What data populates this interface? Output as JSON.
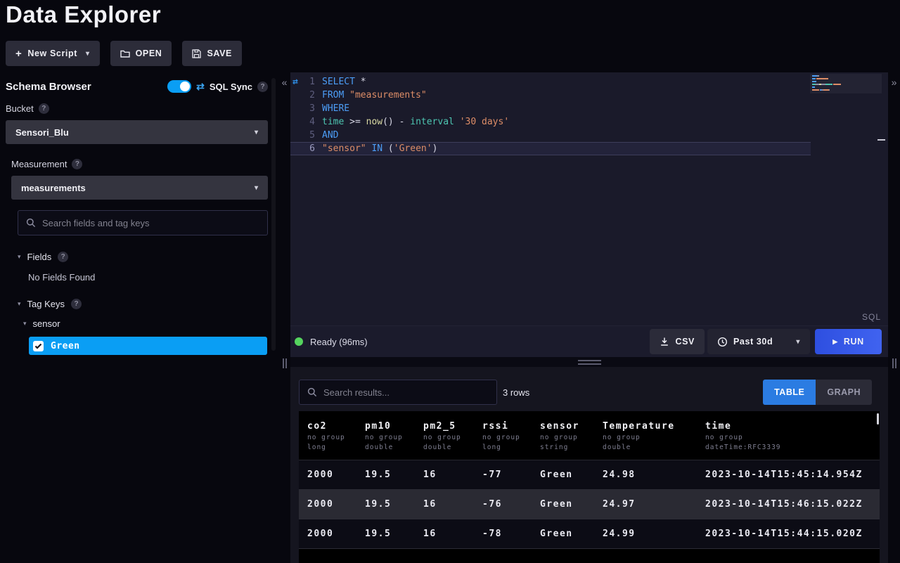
{
  "header": {
    "title": "Data Explorer"
  },
  "toolbar": {
    "new_script": {
      "label": "New Script"
    },
    "open": {
      "label": "OPEN"
    },
    "save": {
      "label": "SAVE"
    }
  },
  "schema_browser": {
    "title": "Schema Browser",
    "sql_sync_label": "SQL Sync",
    "bucket": {
      "label": "Bucket",
      "value": "Sensori_Blu"
    },
    "measurement": {
      "label": "Measurement",
      "value": "measurements"
    },
    "search_placeholder": "Search fields and tag keys",
    "fields": {
      "label": "Fields",
      "empty": "No Fields Found"
    },
    "tag_keys": {
      "label": "Tag Keys",
      "key": "sensor",
      "selected_value": "Green"
    }
  },
  "editor": {
    "language_badge": "SQL",
    "lines": [
      {
        "num": 1,
        "tokens": [
          {
            "t": "SELECT",
            "c": "kw"
          },
          {
            "t": " *",
            "c": "pl"
          }
        ]
      },
      {
        "num": 2,
        "tokens": [
          {
            "t": "FROM",
            "c": "kw"
          },
          {
            "t": " ",
            "c": "pl"
          },
          {
            "t": "\"measurements\"",
            "c": "str"
          }
        ]
      },
      {
        "num": 3,
        "tokens": [
          {
            "t": "WHERE",
            "c": "kw"
          }
        ]
      },
      {
        "num": 4,
        "tokens": [
          {
            "t": "time",
            "c": "id"
          },
          {
            "t": " >= ",
            "c": "pl"
          },
          {
            "t": "now",
            "c": "fn"
          },
          {
            "t": "() - ",
            "c": "pl"
          },
          {
            "t": "interval",
            "c": "id"
          },
          {
            "t": " ",
            "c": "pl"
          },
          {
            "t": "'30 days'",
            "c": "str"
          }
        ]
      },
      {
        "num": 5,
        "tokens": [
          {
            "t": "AND",
            "c": "kw"
          }
        ]
      },
      {
        "num": 6,
        "active": true,
        "tokens": [
          {
            "t": "\"sensor\"",
            "c": "str"
          },
          {
            "t": " ",
            "c": "pl"
          },
          {
            "t": "IN",
            "c": "kw"
          },
          {
            "t": " (",
            "c": "pl"
          },
          {
            "t": "'Green'",
            "c": "str"
          },
          {
            "t": ")",
            "c": "pl"
          }
        ]
      }
    ]
  },
  "statusbar": {
    "status": "Ready (96ms)",
    "csv_label": "CSV",
    "time_range": "Past 30d",
    "run_label": "RUN"
  },
  "results": {
    "search_placeholder": "Search results...",
    "row_count": "3 rows",
    "tabs": [
      {
        "label": "TABLE",
        "active": true
      },
      {
        "label": "GRAPH",
        "active": false
      }
    ],
    "table": {
      "columns": [
        {
          "name": "co2",
          "group": "no group",
          "type": "long"
        },
        {
          "name": "pm10",
          "group": "no group",
          "type": "double"
        },
        {
          "name": "pm2_5",
          "group": "no group",
          "type": "double"
        },
        {
          "name": "rssi",
          "group": "no group",
          "type": "long"
        },
        {
          "name": "sensor",
          "group": "no group",
          "type": "string"
        },
        {
          "name": "Temperature",
          "group": "no group",
          "type": "double"
        },
        {
          "name": "time",
          "group": "no group",
          "type": "dateTime:RFC3339"
        }
      ],
      "rows": [
        [
          "2000",
          "19.5",
          "16",
          "-77",
          "Green",
          "24.98",
          "2023-10-14T15:45:14.954Z"
        ],
        [
          "2000",
          "19.5",
          "16",
          "-76",
          "Green",
          "24.97",
          "2023-10-14T15:46:15.022Z"
        ],
        [
          "2000",
          "19.5",
          "16",
          "-78",
          "Green",
          "24.99",
          "2023-10-14T15:44:15.020Z"
        ]
      ]
    }
  },
  "icons": {
    "help": "?",
    "plus": "+",
    "caret_down": "▾",
    "chevron_expanded": "▾",
    "collapse_left": "«",
    "collapse_right": "»",
    "sql_sync": "⇄",
    "play": "▶"
  },
  "colors": {
    "accent": "#0a9ef4",
    "tab_active": "#2b7ce2",
    "run_start": "#2e4fe0",
    "run_end": "#4063f0",
    "status_green": "#55d45e"
  }
}
